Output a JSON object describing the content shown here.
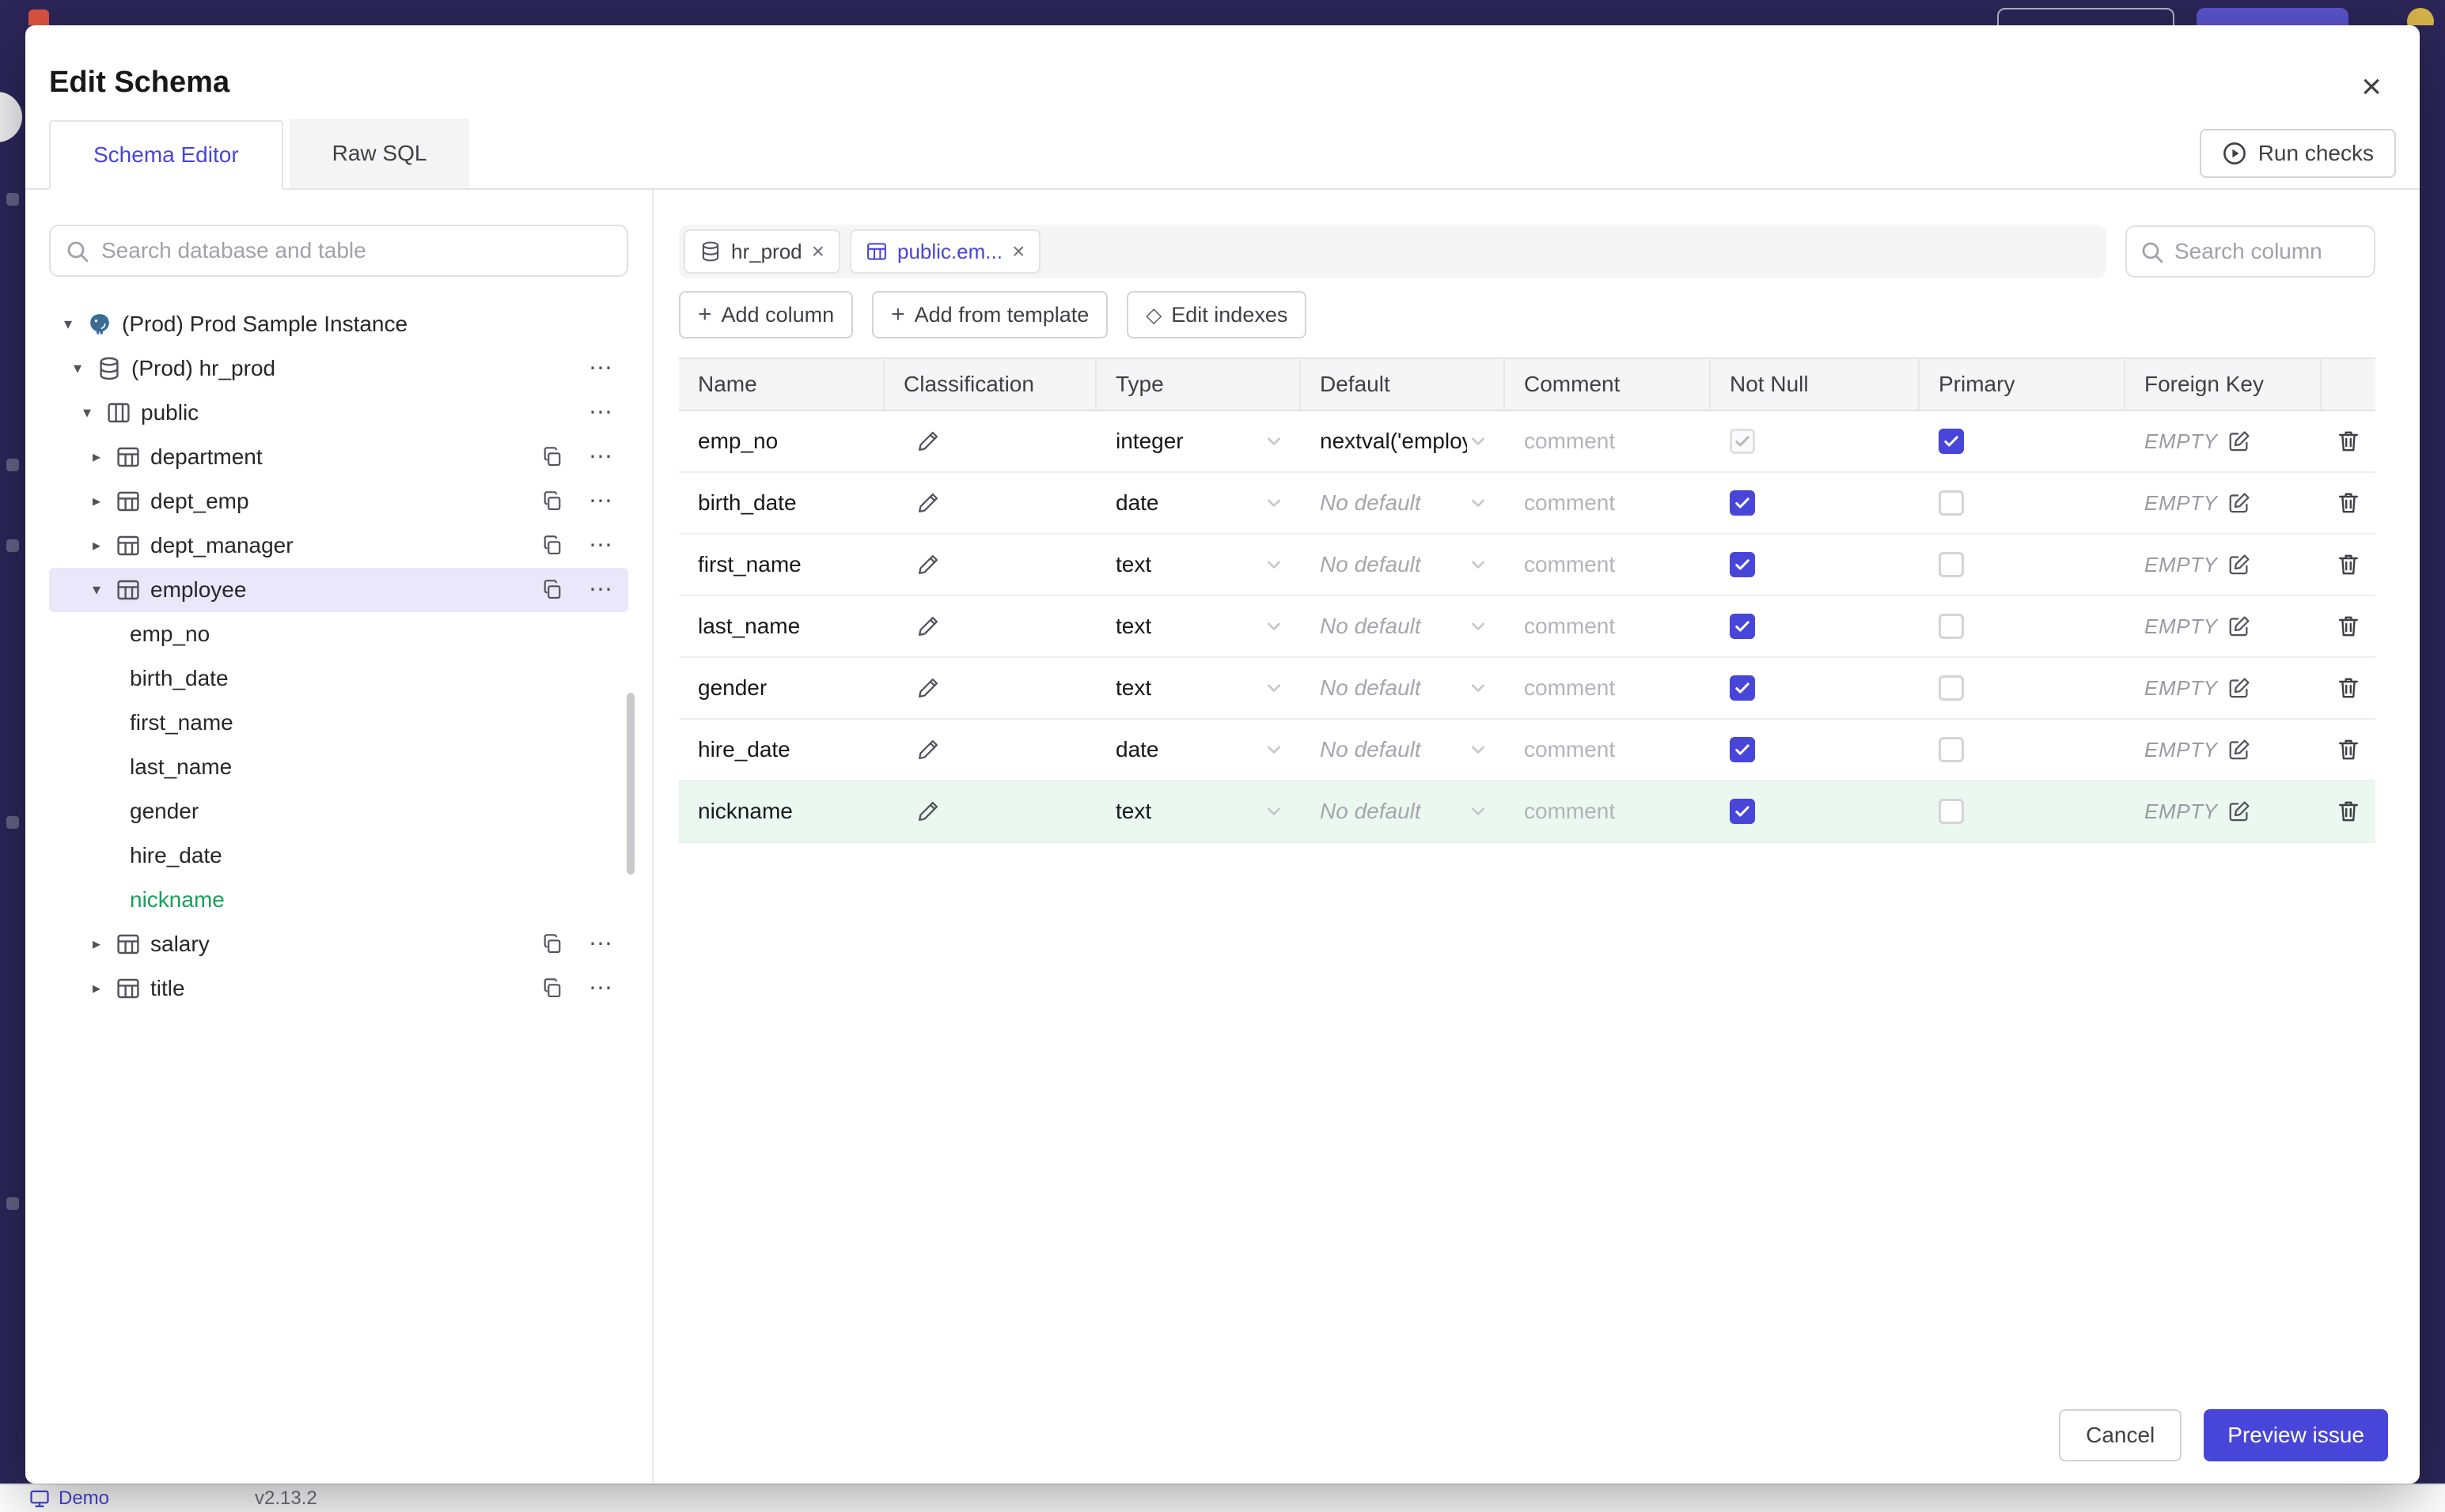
{
  "colors": {
    "accent": "#4845d9",
    "green": "#18a058",
    "topbar": "#2c2659"
  },
  "icons": {
    "plus": "+",
    "close": "×",
    "ellipsis": "⋯",
    "diamond": "◇",
    "caret_down": "▾",
    "caret_right": "▸"
  },
  "background": {
    "footer_brand": "Demo",
    "footer_version": "v2.13.2"
  },
  "modal": {
    "title": "Edit Schema",
    "tabs": [
      {
        "label": "Schema Editor"
      },
      {
        "label": "Raw SQL"
      }
    ],
    "run_checks_label": "Run checks",
    "sidebar": {
      "search_placeholder": "Search database and table",
      "tree": [
        {
          "label": "(Prod) Prod Sample Instance",
          "type": "instance"
        },
        {
          "label": "(Prod) hr_prod",
          "type": "database"
        },
        {
          "label": "public",
          "type": "schema"
        },
        {
          "label": "department",
          "type": "table"
        },
        {
          "label": "dept_emp",
          "type": "table"
        },
        {
          "label": "dept_manager",
          "type": "table"
        },
        {
          "label": "employee",
          "type": "table",
          "selected": true,
          "expanded": true
        },
        {
          "label": "emp_no",
          "type": "column"
        },
        {
          "label": "birth_date",
          "type": "column"
        },
        {
          "label": "first_name",
          "type": "column"
        },
        {
          "label": "last_name",
          "type": "column"
        },
        {
          "label": "gender",
          "type": "column"
        },
        {
          "label": "hire_date",
          "type": "column"
        },
        {
          "label": "nickname",
          "type": "column",
          "highlight": "green"
        },
        {
          "label": "salary",
          "type": "table"
        },
        {
          "label": "title",
          "type": "table"
        }
      ]
    },
    "main": {
      "chips": [
        {
          "label": "hr_prod",
          "icon": "database",
          "active": false
        },
        {
          "label": "public.em...",
          "icon": "table",
          "active": true
        }
      ],
      "column_search_placeholder": "Search column",
      "actions": {
        "add_column": "Add column",
        "add_from_template": "Add from template",
        "edit_indexes": "Edit indexes"
      },
      "table": {
        "headers": [
          "Name",
          "Classification",
          "Type",
          "Default",
          "Comment",
          "Not Null",
          "Primary",
          "Foreign Key"
        ],
        "rows": [
          {
            "name": "emp_no",
            "type": "integer",
            "default": "nextval('employ",
            "comment_placeholder": "comment",
            "not_null": "checked-disabled",
            "primary": "checked",
            "foreign_key": "EMPTY"
          },
          {
            "name": "birth_date",
            "type": "date",
            "default": "No default",
            "comment_placeholder": "comment",
            "not_null": "checked",
            "primary": "unchecked",
            "foreign_key": "EMPTY"
          },
          {
            "name": "first_name",
            "type": "text",
            "default": "No default",
            "comment_placeholder": "comment",
            "not_null": "checked",
            "primary": "unchecked",
            "foreign_key": "EMPTY"
          },
          {
            "name": "last_name",
            "type": "text",
            "default": "No default",
            "comment_placeholder": "comment",
            "not_null": "checked",
            "primary": "unchecked",
            "foreign_key": "EMPTY"
          },
          {
            "name": "gender",
            "type": "text",
            "default": "No default",
            "comment_placeholder": "comment",
            "not_null": "checked",
            "primary": "unchecked",
            "foreign_key": "EMPTY"
          },
          {
            "name": "hire_date",
            "type": "date",
            "default": "No default",
            "comment_placeholder": "comment",
            "not_null": "checked",
            "primary": "unchecked",
            "foreign_key": "EMPTY"
          },
          {
            "name": "nickname",
            "type": "text",
            "default": "No default",
            "comment_placeholder": "comment",
            "not_null": "checked",
            "primary": "unchecked",
            "foreign_key": "EMPTY",
            "highlight": "green"
          }
        ]
      }
    },
    "footer": {
      "cancel": "Cancel",
      "preview": "Preview issue"
    }
  }
}
